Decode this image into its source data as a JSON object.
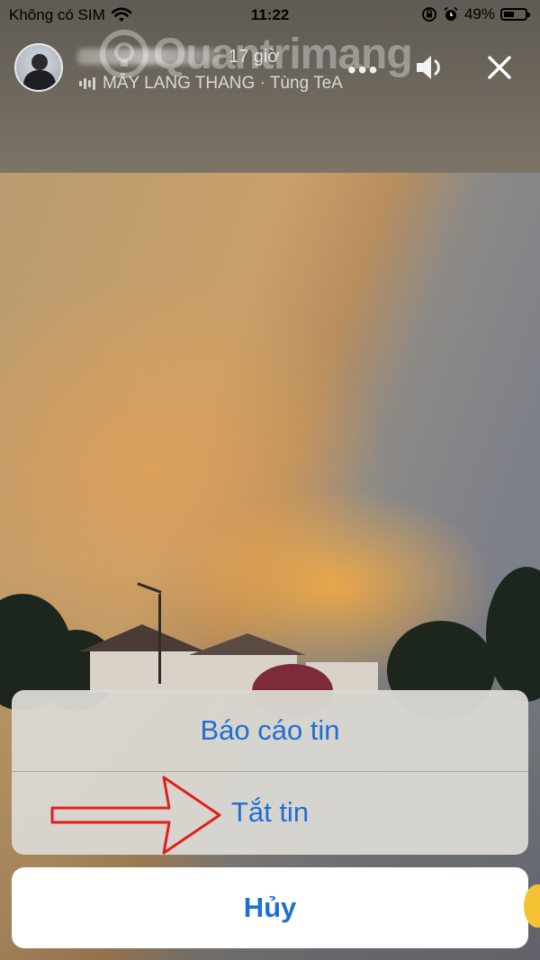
{
  "status_bar": {
    "carrier": "Không có SIM",
    "time": "11:22",
    "battery_percent": "49%",
    "battery_level": 0.49
  },
  "story": {
    "time_ago": "17 giờ",
    "music": "MÂY LANG THANG · Tùng TeA"
  },
  "watermark": "Quantrimang",
  "action_sheet": {
    "report_label": "Báo cáo tin",
    "mute_label": "Tắt tin",
    "cancel_label": "Hủy"
  },
  "colors": {
    "action_blue": "#1e6fd2",
    "annotation_red": "#e0201a"
  },
  "icons": [
    "wifi-icon",
    "orientation-lock-icon",
    "alarm-icon",
    "battery-icon",
    "more-icon",
    "speaker-icon",
    "close-icon",
    "music-wave-icon",
    "arrow-annotation-icon"
  ]
}
